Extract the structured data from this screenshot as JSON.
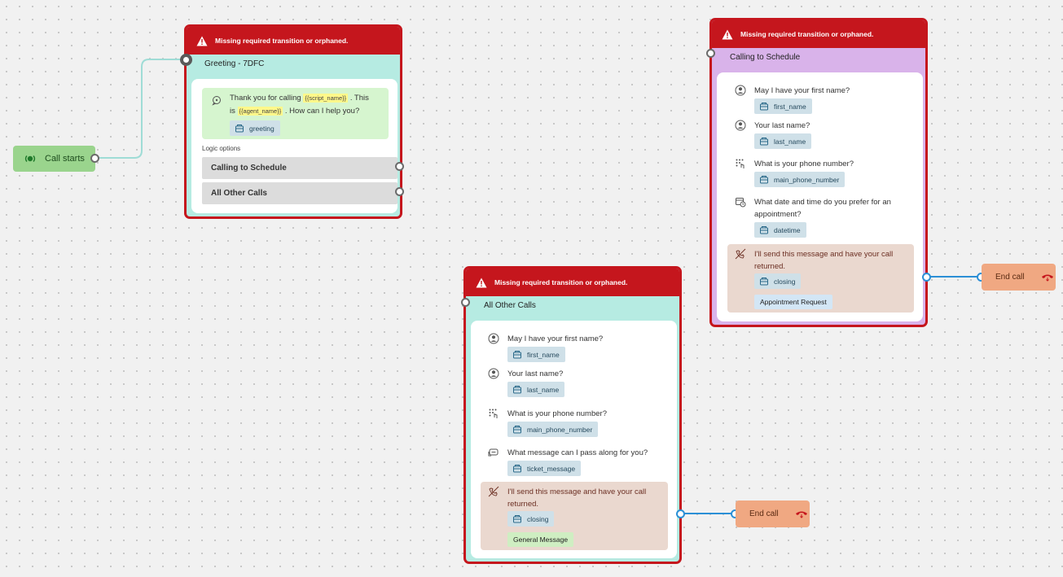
{
  "start": {
    "label": "Call starts"
  },
  "warning_text": "Missing required transition or orphaned.",
  "greeting": {
    "title": "Greeting - 7DFC",
    "text_pre": "Thank you for calling",
    "var_script_name": "{{script_name}}",
    "text_mid1": ". This",
    "text_is": "is",
    "var_agent_name": "{{agent_name}}",
    "text_post": ". How can I help you?",
    "chip": "greeting",
    "logic_label": "Logic options",
    "options": [
      "Calling to Schedule",
      "All Other Calls"
    ]
  },
  "schedule": {
    "title": "Calling to Schedule",
    "steps": [
      {
        "q": "May I have your first name?",
        "var": "first_name",
        "icon": "person-icon"
      },
      {
        "q": "Your last name?",
        "var": "last_name",
        "icon": "person-icon"
      },
      {
        "q": "What is your phone number?",
        "var": "main_phone_number",
        "icon": "phone-keypad-icon"
      },
      {
        "q_line1": "What date and time do you prefer for an",
        "q_line2": "appointment?",
        "var": "datetime",
        "icon": "calendar-clock-icon"
      }
    ],
    "closing": {
      "line1": "I'll send this message and have your call",
      "line2": "returned.",
      "var": "closing",
      "tag": "Appointment Request",
      "tag_color": "#d3e6f5"
    }
  },
  "other": {
    "title": "All Other Calls",
    "steps": [
      {
        "q": "May I have your first name?",
        "var": "first_name",
        "icon": "person-icon"
      },
      {
        "q": "Your last name?",
        "var": "last_name",
        "icon": "person-icon"
      },
      {
        "q": "What is your phone number?",
        "var": "main_phone_number",
        "icon": "phone-keypad-icon"
      },
      {
        "q": "What message can I pass along for you?",
        "var": "ticket_message",
        "icon": "message-icon"
      }
    ],
    "closing": {
      "line1": "I'll send this message and have your call",
      "line2": "returned.",
      "var": "closing",
      "tag": "General Message",
      "tag_color": "#cfeec2"
    }
  },
  "end_nodes": [
    "End call",
    "End call"
  ],
  "colors": {
    "error_red": "#c5161d",
    "teal_node": "#b6ebe2",
    "lilac_node": "#d9b3ea",
    "start_green": "#9ad48d",
    "end_orange": "#f0a882",
    "edge_blue": "#2b8fd6",
    "edge_teal": "#9fdcd6"
  }
}
